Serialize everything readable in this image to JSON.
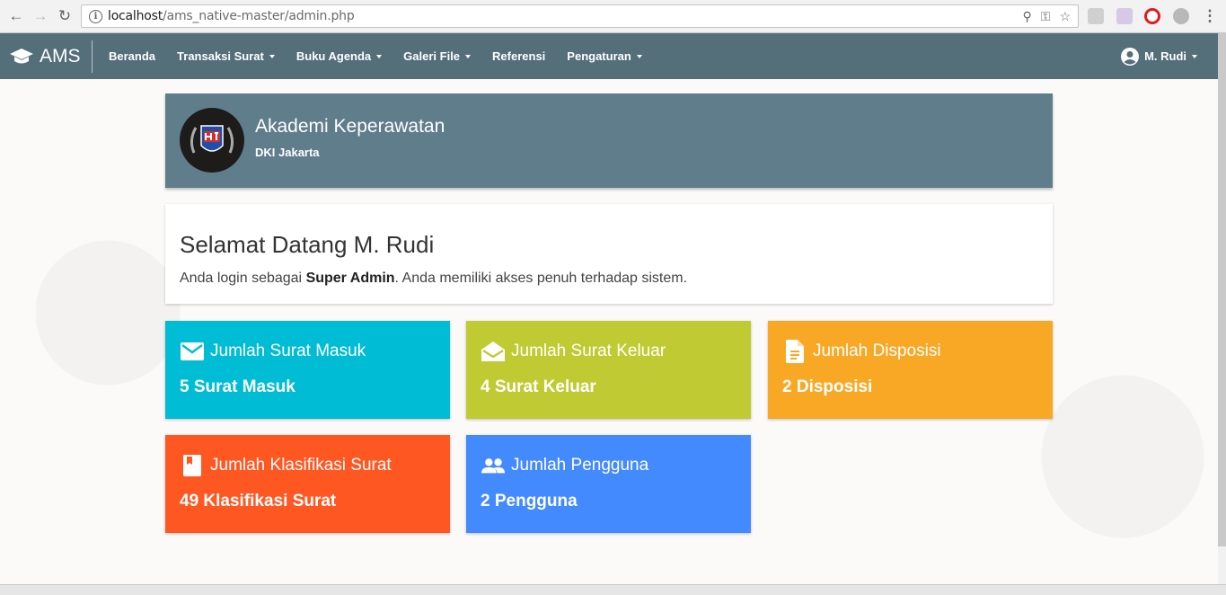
{
  "browser": {
    "url_host": "localhost",
    "url_path": "/ams_native-master/admin.php"
  },
  "navbar": {
    "brand": "AMS",
    "menu": [
      {
        "label": "Beranda",
        "dropdown": false
      },
      {
        "label": "Transaksi Surat",
        "dropdown": true
      },
      {
        "label": "Buku Agenda",
        "dropdown": true
      },
      {
        "label": "Galeri File",
        "dropdown": true
      },
      {
        "label": "Referensi",
        "dropdown": false
      },
      {
        "label": "Pengaturan",
        "dropdown": true
      }
    ],
    "user": "M. Rudi"
  },
  "institution": {
    "name": "Akademi Keperawatan",
    "city": "DKI Jakarta"
  },
  "welcome": {
    "title": "Selamat Datang M. Rudi",
    "text_before": "Anda login sebagai ",
    "role": "Super Admin",
    "text_after": ". Anda memiliki akses penuh terhadap sistem."
  },
  "stats": [
    {
      "title": "Jumlah Surat Masuk",
      "value": "5 Surat Masuk",
      "color": "#00bcd4",
      "icon": "mail-icon"
    },
    {
      "title": "Jumlah Surat Keluar",
      "value": "4 Surat Keluar",
      "color": "#c0ca33",
      "icon": "open-mail-icon"
    },
    {
      "title": "Jumlah Disposisi",
      "value": "2 Disposisi",
      "color": "#f9a825",
      "icon": "document-icon"
    },
    {
      "title": "Jumlah Klasifikasi Surat",
      "value": "49 Klasifikasi Surat",
      "color": "#ff5722",
      "icon": "book-icon"
    },
    {
      "title": "Jumlah Pengguna",
      "value": "2 Pengguna",
      "color": "#448aff",
      "icon": "people-icon"
    }
  ],
  "colors": {
    "navbar": "#546e7a",
    "header_card": "#607d8b"
  }
}
